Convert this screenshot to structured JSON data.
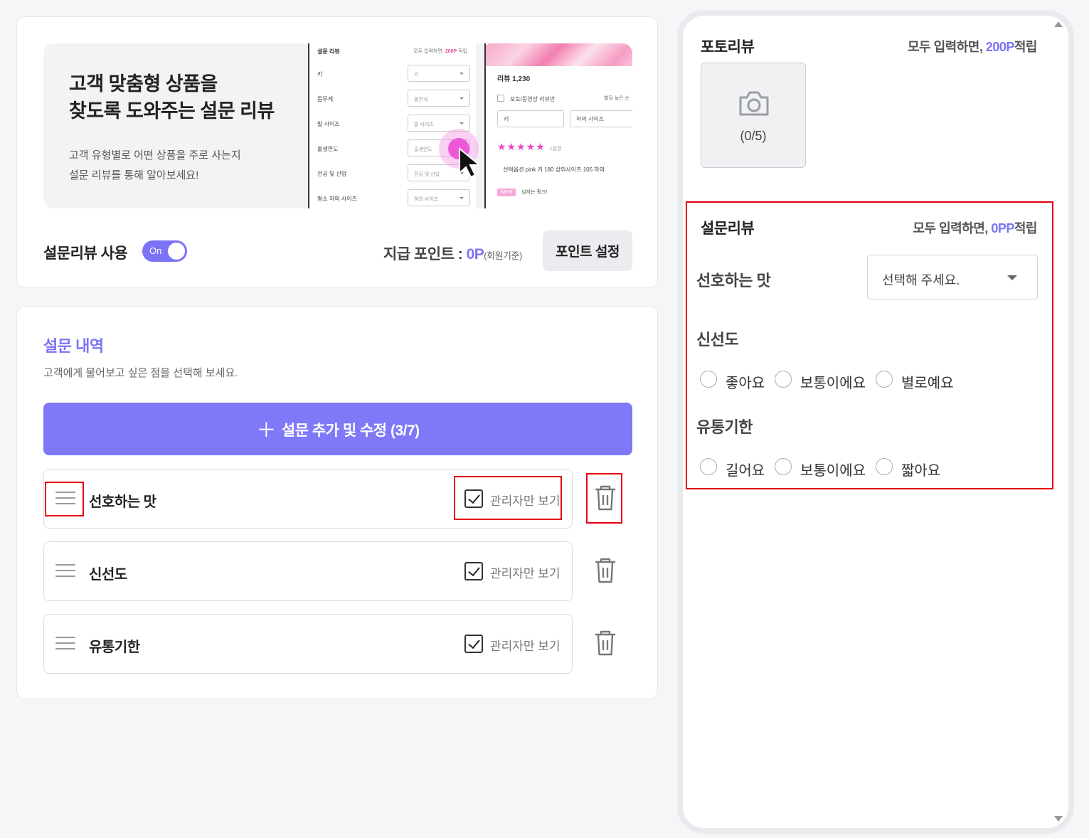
{
  "banner": {
    "title_line1": "고객 맞춤형 상품을",
    "title_line2": "찾도록 도와주는 설문 리뷰",
    "sub_line1": "고객 유형별로 어떤 상품을 주로 사는지",
    "sub_line2": "설문 리뷰를 통해 알아보세요!",
    "mock_survey": {
      "title": "설문 리뷰",
      "points_prefix": "모두 입력하면, ",
      "points_value": "200P",
      "points_suffix": " 적립",
      "rows": [
        {
          "label": "키",
          "value": "키"
        },
        {
          "label": "몸무게",
          "value": "몸무게"
        },
        {
          "label": "발 사이즈",
          "value": "발 사이즈"
        },
        {
          "label": "출생연도",
          "value": "출생연도"
        },
        {
          "label": "전공 및 산업",
          "value": "전공 및 산업"
        },
        {
          "label": "평소 하의 사이즈",
          "value": "하의 사이즈"
        }
      ]
    },
    "mock_review": {
      "count": "리뷰 1,230",
      "photo_only": "포토/동영상 리뷰만",
      "sort": "별점 높은 순",
      "select1": "키",
      "select2": "하의 사이즈",
      "stars": "★★★★★",
      "date": "1일전",
      "option": "선택옵션 pink   키 180   상의사이즈 105   하의",
      "new_badge": "NEW",
      "new_text": "남자는 핑크!"
    }
  },
  "settings": {
    "use_label": "설문리뷰 사용",
    "toggle_label": "On",
    "pay_label": "지급 포인트 : ",
    "pay_value": "0P",
    "pay_note": "(회원기준)",
    "point_button": "포인트 설정"
  },
  "survey_list": {
    "title": "설문 내역",
    "desc": "고객에게 물어보고 싶은 점을 선택해 보세요.",
    "add_button": "설문 추가 및 수정 (3/7)",
    "items": [
      {
        "name": "선호하는 맛",
        "admin_label": "관리자만 보기",
        "admin_checked": true
      },
      {
        "name": "신선도",
        "admin_label": "관리자만 보기",
        "admin_checked": true
      },
      {
        "name": "유통기한",
        "admin_label": "관리자만 보기",
        "admin_checked": true
      }
    ]
  },
  "preview": {
    "photo_review": {
      "title": "포토리뷰",
      "info_prefix": "모두 입력하면, ",
      "info_value": "200P",
      "info_suffix": "적립",
      "photo_count": "(0/5)"
    },
    "survey_review": {
      "title": "설문리뷰",
      "info_prefix": "모두 입력하면, ",
      "info_value": "0PP",
      "info_suffix": "적립",
      "questions": [
        {
          "label": "선호하는 맛",
          "type": "select",
          "placeholder": "선택해 주세요."
        },
        {
          "label": "신선도",
          "type": "radio",
          "options": [
            "좋아요",
            "보통이에요",
            "별로예요"
          ]
        },
        {
          "label": "유통기한",
          "type": "radio",
          "options": [
            "길어요",
            "보통이에요",
            "짧아요"
          ]
        }
      ]
    }
  },
  "colors": {
    "accent": "#7b73f5",
    "highlight": "#e60012",
    "pink": "#e945c4"
  }
}
